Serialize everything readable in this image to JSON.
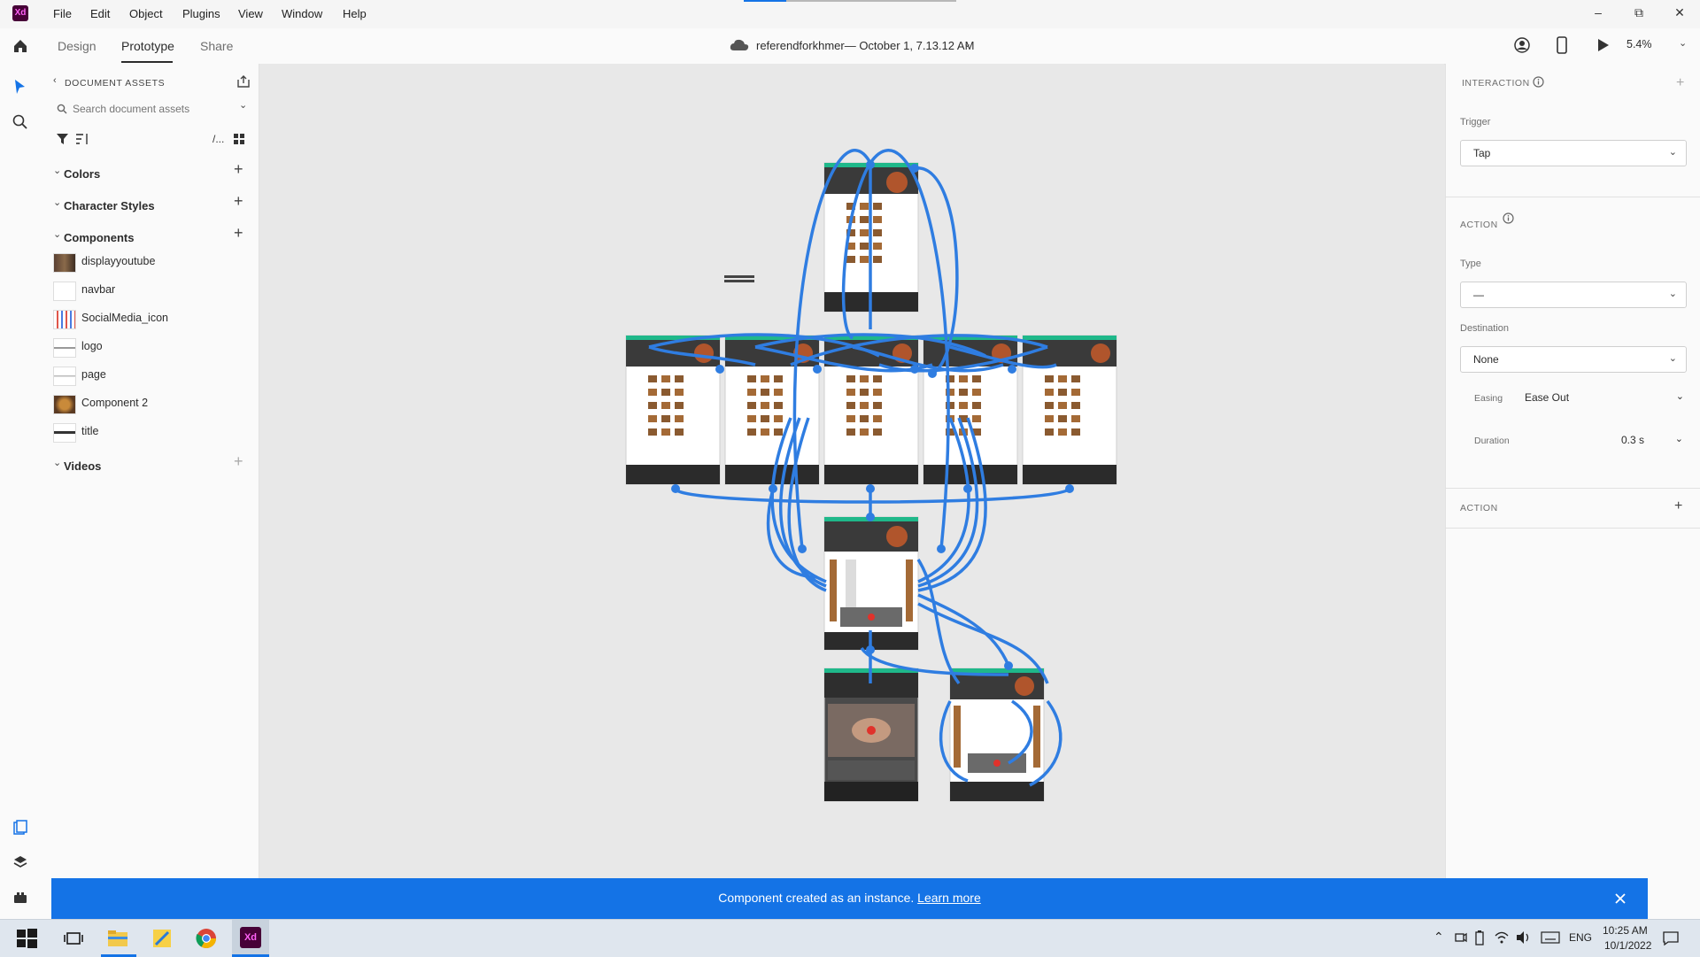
{
  "app": {
    "logo_text": "Xd",
    "menu": [
      "File",
      "Edit",
      "Object",
      "Plugins",
      "View",
      "Window",
      "Help"
    ]
  },
  "toolbar": {
    "tabs": [
      "Design",
      "Prototype",
      "Share"
    ],
    "active_tab": "Prototype",
    "document_title": "referendforkhmer— October 1, 7.13.12 AM",
    "zoom": "5.4%"
  },
  "assets": {
    "header": "DOCUMENT ASSETS",
    "search_placeholder": "Search document assets",
    "path_label": "/...",
    "sections": {
      "colors": "Colors",
      "character_styles": "Character Styles",
      "components": "Components",
      "videos": "Videos"
    },
    "components": [
      "displayyoutube",
      "navbar",
      "SocialMedia_icon",
      "logo",
      "page",
      "Component 2",
      "title"
    ]
  },
  "inspector": {
    "interaction_header": "INTERACTION",
    "trigger_label": "Trigger",
    "trigger_value": "Tap",
    "action_header": "ACTION",
    "type_label": "Type",
    "type_value": "—",
    "destination_label": "Destination",
    "destination_value": "None",
    "easing_label": "Easing",
    "easing_value": "Ease Out",
    "duration_label": "Duration",
    "duration_value": "0.3 s",
    "action2_header": "ACTION"
  },
  "toast": {
    "message": "Component created as an instance.",
    "link": "Learn more"
  },
  "taskbar": {
    "language": "ENG",
    "time": "10:25 AM",
    "date": "10/1/2022",
    "xd_label": "Xd"
  },
  "colors": {
    "accent": "#1473e6",
    "wire": "#2f7de1",
    "artboard_header": "#1fb88a",
    "xd_brand": "#470137"
  }
}
